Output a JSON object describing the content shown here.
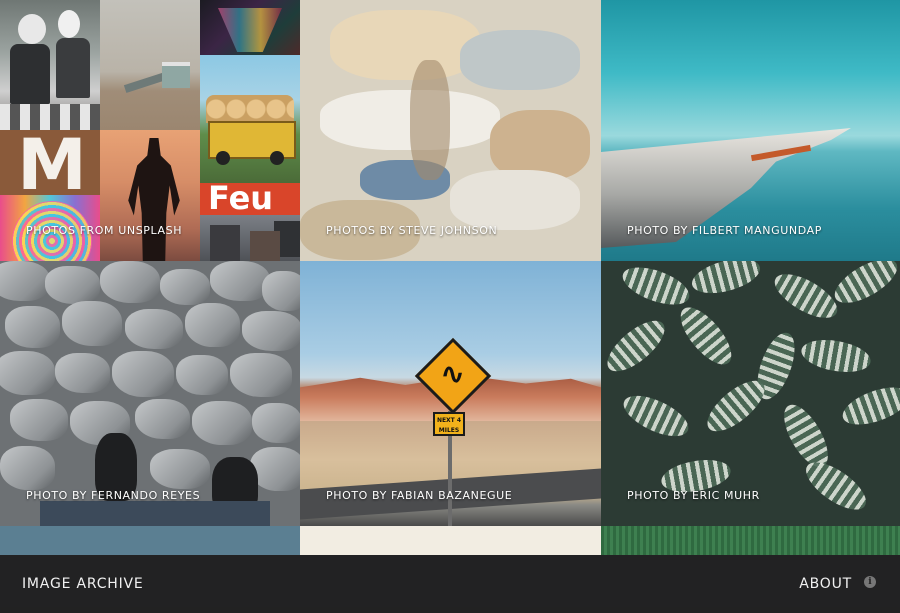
{
  "gallery": {
    "tiles": [
      {
        "caption": "PHOTOS FROM UNSPLASH"
      },
      {
        "caption": "PHOTOS BY STEVE JOHNSON"
      },
      {
        "caption": "PHOTO BY FILBERT MANGUNDAP"
      },
      {
        "caption": "PHOTO BY FERNANDO REYES"
      },
      {
        "caption": "PHOTO BY FABIAN BAZANEGUE"
      },
      {
        "caption": "PHOTO BY ERIC MUHR"
      }
    ],
    "mosaic_text": "Feu",
    "sign_text": "NEXT 4 MILES"
  },
  "footer": {
    "brand": "IMAGE ARCHIVE",
    "about_label": "ABOUT",
    "info_icon": "info-icon"
  }
}
